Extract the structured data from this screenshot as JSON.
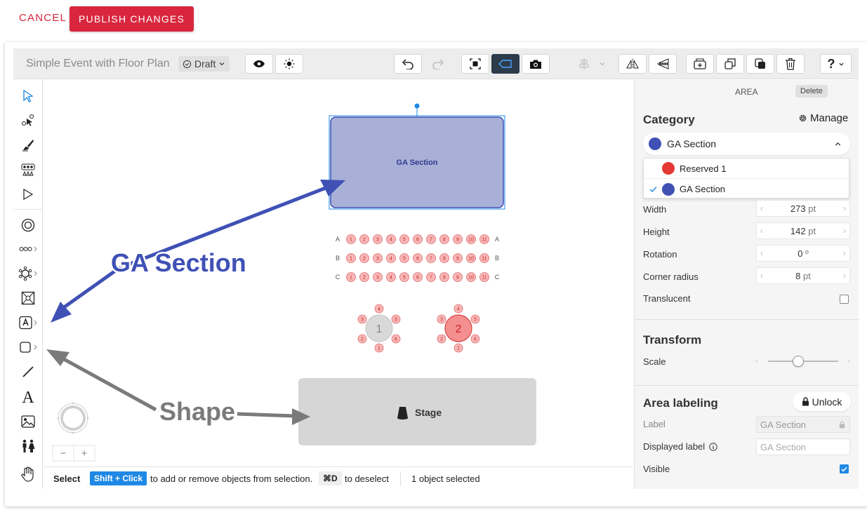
{
  "topbar": {
    "cancel": "CANCEL",
    "publish": "PUBLISH CHANGES"
  },
  "toolbar": {
    "doc_title": "Simple Event with Floor Plan",
    "status": "Draft",
    "help": "?"
  },
  "canvas": {
    "ga_label": "GA Section",
    "stage_label": "Stage",
    "annotation_ga": "GA Section",
    "annotation_shape": "Shape",
    "rows": [
      "A",
      "B",
      "C"
    ],
    "seats": [
      "1",
      "2",
      "3",
      "4",
      "5",
      "6",
      "7",
      "8",
      "9",
      "10",
      "11"
    ],
    "table1": "1",
    "table2": "2",
    "table_seats": [
      "1",
      "2",
      "3",
      "4",
      "5",
      "6"
    ],
    "zoom_out": "−",
    "zoom_in": "+"
  },
  "statusbar": {
    "select": "Select",
    "shortcut": "Shift + Click",
    "hint": "to add or remove objects from selection.",
    "deselect_key": "⌘D",
    "deselect_hint": "to deselect",
    "count": "1 object selected"
  },
  "panel": {
    "header": "AREA",
    "delete_tip": "Delete",
    "category_title": "Category",
    "manage": "Manage",
    "selected": "GA Section",
    "options": [
      {
        "label": "Reserved 1",
        "color": "#e53935"
      },
      {
        "label": "GA Section",
        "color": "#3f51b5"
      }
    ],
    "width_label": "Width",
    "width_value": "273",
    "width_unit": "pt",
    "height_label": "Height",
    "height_value": "142",
    "height_unit": "pt",
    "rotation_label": "Rotation",
    "rotation_value": "0",
    "rotation_unit": "º",
    "radius_label": "Corner radius",
    "radius_value": "8",
    "radius_unit": "pt",
    "translucent_label": "Translucent",
    "transform_title": "Transform",
    "scale_label": "Scale",
    "scale_level": 0.35,
    "labeling_title": "Area labeling",
    "unlock": "Unlock",
    "label_label": "Label",
    "label_value": "GA Section",
    "displayed_label": "Displayed label",
    "displayed_value": "GA Section",
    "visible_label": "Visible"
  },
  "colors": {
    "accent": "#d9263e",
    "ga": "#3f51b5",
    "ga_fill": "#a8b0d8",
    "stage": "#d6d6d6",
    "selected_tool": "#2d3b4a",
    "seat": "#f7b7b7",
    "table": "#d9d9d9",
    "table_selected": "#f48f8f"
  }
}
